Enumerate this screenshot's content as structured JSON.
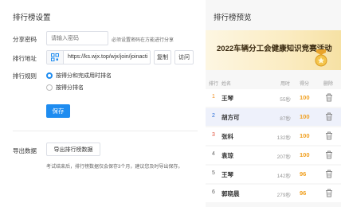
{
  "settings": {
    "title": "排行榜设置",
    "password": {
      "label": "分享密码",
      "placeholder": "请输入密码",
      "hint": "必须设置密码在方能进行分享"
    },
    "address": {
      "label": "排行地址",
      "url": "https://ks.wjx.top/wjx/join/joinacti",
      "copy_label": "复制",
      "visit_label": "访问"
    },
    "rule": {
      "label": "排行规则",
      "options": [
        {
          "label": "按得分和完成用时排名",
          "selected": true
        },
        {
          "label": "按得分排名",
          "selected": false
        }
      ]
    },
    "save_label": "保存",
    "export": {
      "label": "导出数据",
      "button_label": "导出排行榜数据",
      "note": "考试结束后，排行榜数据仅会保存3个月，建议您及时导出保存。"
    }
  },
  "preview": {
    "title": "排行榜预览",
    "banner_title": "2022车辆分工会健康知识竞赛活动",
    "columns": {
      "rank": "排行",
      "name": "姓名",
      "time": "用时",
      "score": "得分",
      "delete": "删除"
    },
    "rows": [
      {
        "rank": "1",
        "name": "王琴",
        "time": "55秒",
        "score": "100"
      },
      {
        "rank": "2",
        "name": "胡方可",
        "time": "87秒",
        "score": "100"
      },
      {
        "rank": "3",
        "name": "张科",
        "time": "132秒",
        "score": "100"
      },
      {
        "rank": "4",
        "name": "袁琼",
        "time": "207秒",
        "score": "100"
      },
      {
        "rank": "5",
        "name": "王琴",
        "time": "142秒",
        "score": "96"
      },
      {
        "rank": "6",
        "name": "郭晓晨",
        "time": "279秒",
        "score": "96"
      }
    ],
    "rank_colors": {
      "1": "#f08c1e",
      "2": "#2b6fd8",
      "3": "#e0533e",
      "default": "#666666"
    },
    "score_color": "#f0a020"
  },
  "colors": {
    "accent": "#1e8cf0"
  }
}
